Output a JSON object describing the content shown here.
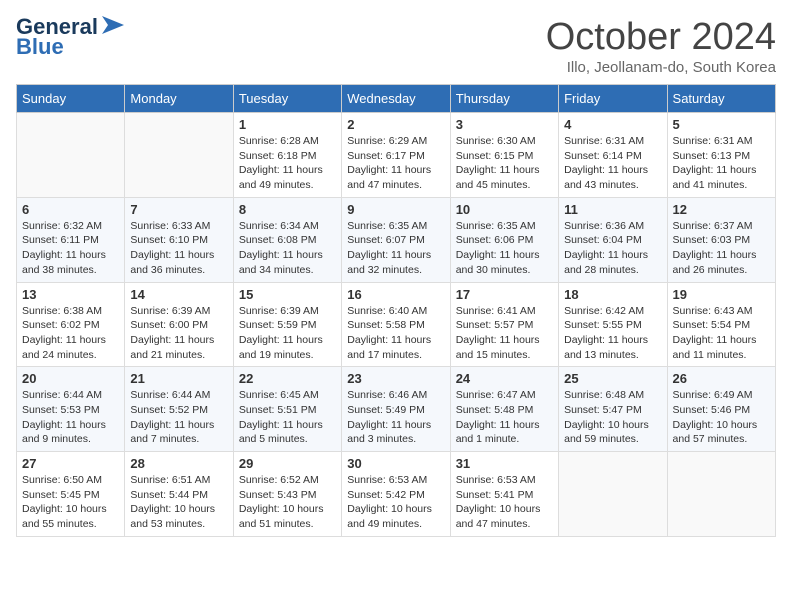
{
  "header": {
    "logo_line1": "General",
    "logo_line2": "Blue",
    "month": "October 2024",
    "location": "Illo, Jeollanam-do, South Korea"
  },
  "days_of_week": [
    "Sunday",
    "Monday",
    "Tuesday",
    "Wednesday",
    "Thursday",
    "Friday",
    "Saturday"
  ],
  "weeks": [
    [
      {
        "day": "",
        "text": ""
      },
      {
        "day": "",
        "text": ""
      },
      {
        "day": "1",
        "text": "Sunrise: 6:28 AM\nSunset: 6:18 PM\nDaylight: 11 hours and 49 minutes."
      },
      {
        "day": "2",
        "text": "Sunrise: 6:29 AM\nSunset: 6:17 PM\nDaylight: 11 hours and 47 minutes."
      },
      {
        "day": "3",
        "text": "Sunrise: 6:30 AM\nSunset: 6:15 PM\nDaylight: 11 hours and 45 minutes."
      },
      {
        "day": "4",
        "text": "Sunrise: 6:31 AM\nSunset: 6:14 PM\nDaylight: 11 hours and 43 minutes."
      },
      {
        "day": "5",
        "text": "Sunrise: 6:31 AM\nSunset: 6:13 PM\nDaylight: 11 hours and 41 minutes."
      }
    ],
    [
      {
        "day": "6",
        "text": "Sunrise: 6:32 AM\nSunset: 6:11 PM\nDaylight: 11 hours and 38 minutes."
      },
      {
        "day": "7",
        "text": "Sunrise: 6:33 AM\nSunset: 6:10 PM\nDaylight: 11 hours and 36 minutes."
      },
      {
        "day": "8",
        "text": "Sunrise: 6:34 AM\nSunset: 6:08 PM\nDaylight: 11 hours and 34 minutes."
      },
      {
        "day": "9",
        "text": "Sunrise: 6:35 AM\nSunset: 6:07 PM\nDaylight: 11 hours and 32 minutes."
      },
      {
        "day": "10",
        "text": "Sunrise: 6:35 AM\nSunset: 6:06 PM\nDaylight: 11 hours and 30 minutes."
      },
      {
        "day": "11",
        "text": "Sunrise: 6:36 AM\nSunset: 6:04 PM\nDaylight: 11 hours and 28 minutes."
      },
      {
        "day": "12",
        "text": "Sunrise: 6:37 AM\nSunset: 6:03 PM\nDaylight: 11 hours and 26 minutes."
      }
    ],
    [
      {
        "day": "13",
        "text": "Sunrise: 6:38 AM\nSunset: 6:02 PM\nDaylight: 11 hours and 24 minutes."
      },
      {
        "day": "14",
        "text": "Sunrise: 6:39 AM\nSunset: 6:00 PM\nDaylight: 11 hours and 21 minutes."
      },
      {
        "day": "15",
        "text": "Sunrise: 6:39 AM\nSunset: 5:59 PM\nDaylight: 11 hours and 19 minutes."
      },
      {
        "day": "16",
        "text": "Sunrise: 6:40 AM\nSunset: 5:58 PM\nDaylight: 11 hours and 17 minutes."
      },
      {
        "day": "17",
        "text": "Sunrise: 6:41 AM\nSunset: 5:57 PM\nDaylight: 11 hours and 15 minutes."
      },
      {
        "day": "18",
        "text": "Sunrise: 6:42 AM\nSunset: 5:55 PM\nDaylight: 11 hours and 13 minutes."
      },
      {
        "day": "19",
        "text": "Sunrise: 6:43 AM\nSunset: 5:54 PM\nDaylight: 11 hours and 11 minutes."
      }
    ],
    [
      {
        "day": "20",
        "text": "Sunrise: 6:44 AM\nSunset: 5:53 PM\nDaylight: 11 hours and 9 minutes."
      },
      {
        "day": "21",
        "text": "Sunrise: 6:44 AM\nSunset: 5:52 PM\nDaylight: 11 hours and 7 minutes."
      },
      {
        "day": "22",
        "text": "Sunrise: 6:45 AM\nSunset: 5:51 PM\nDaylight: 11 hours and 5 minutes."
      },
      {
        "day": "23",
        "text": "Sunrise: 6:46 AM\nSunset: 5:49 PM\nDaylight: 11 hours and 3 minutes."
      },
      {
        "day": "24",
        "text": "Sunrise: 6:47 AM\nSunset: 5:48 PM\nDaylight: 11 hours and 1 minute."
      },
      {
        "day": "25",
        "text": "Sunrise: 6:48 AM\nSunset: 5:47 PM\nDaylight: 10 hours and 59 minutes."
      },
      {
        "day": "26",
        "text": "Sunrise: 6:49 AM\nSunset: 5:46 PM\nDaylight: 10 hours and 57 minutes."
      }
    ],
    [
      {
        "day": "27",
        "text": "Sunrise: 6:50 AM\nSunset: 5:45 PM\nDaylight: 10 hours and 55 minutes."
      },
      {
        "day": "28",
        "text": "Sunrise: 6:51 AM\nSunset: 5:44 PM\nDaylight: 10 hours and 53 minutes."
      },
      {
        "day": "29",
        "text": "Sunrise: 6:52 AM\nSunset: 5:43 PM\nDaylight: 10 hours and 51 minutes."
      },
      {
        "day": "30",
        "text": "Sunrise: 6:53 AM\nSunset: 5:42 PM\nDaylight: 10 hours and 49 minutes."
      },
      {
        "day": "31",
        "text": "Sunrise: 6:53 AM\nSunset: 5:41 PM\nDaylight: 10 hours and 47 minutes."
      },
      {
        "day": "",
        "text": ""
      },
      {
        "day": "",
        "text": ""
      }
    ]
  ]
}
